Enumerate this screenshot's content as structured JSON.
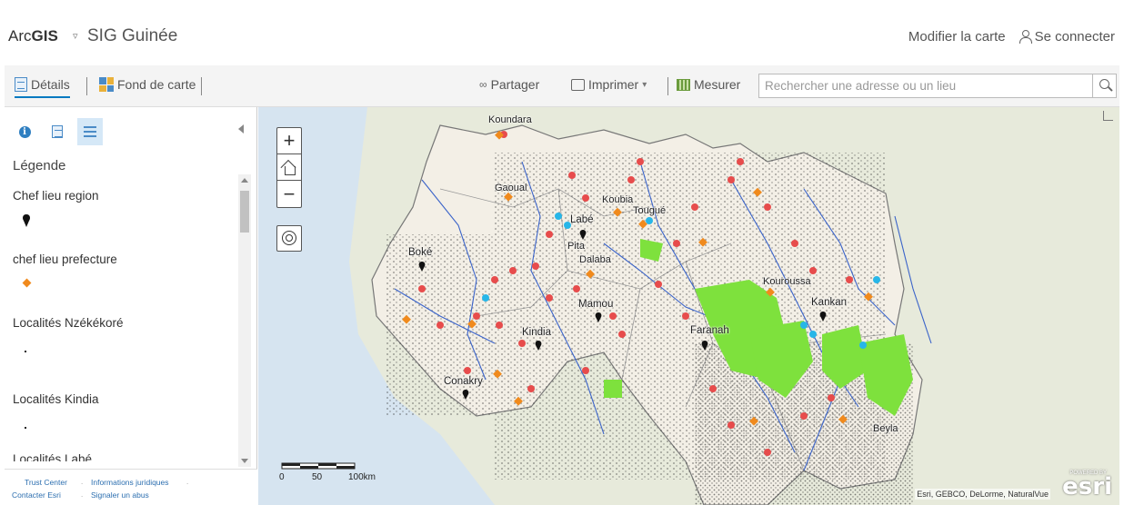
{
  "header": {
    "brand_prefix": "Arc",
    "brand_bold": "GIS",
    "brand_caret": "▿",
    "map_title": "SIG Guinée",
    "modify_map": "Modifier la carte",
    "sign_in": "Se connecter"
  },
  "toolbar": {
    "details": "Détails",
    "basemap": "Fond de carte",
    "share": "Partager",
    "print": "Imprimer",
    "print_caret": "▾",
    "measure": "Mesurer",
    "search_placeholder": "Rechercher une adresse ou un lieu"
  },
  "sidebar": {
    "legend_title": "Légende",
    "layers": [
      {
        "name": "Chef lieu region",
        "symbol": "black-pin"
      },
      {
        "name": "chef lieu prefecture",
        "symbol": "orange-diamond"
      },
      {
        "name": "Localités Nzékékoré",
        "symbol": "dot"
      },
      {
        "name": "Localités Kindia",
        "symbol": "dot"
      },
      {
        "name": "Localités Labé",
        "symbol": "dot"
      }
    ],
    "footer": {
      "trust": "Trust Center",
      "legal": "Informations juridiques",
      "contact": "Contacter Esri",
      "report": "Signaler un abus"
    }
  },
  "map": {
    "zoom_in": "+",
    "zoom_out": "−",
    "cities": [
      {
        "name": "Koundara",
        "symbol": "black-pin"
      },
      {
        "name": "Gaoual",
        "symbol": "black-pin"
      },
      {
        "name": "Koubia",
        "symbol": "black-pin"
      },
      {
        "name": "Tougué",
        "symbol": "black-pin"
      },
      {
        "name": "Labé",
        "symbol": "black-pin"
      },
      {
        "name": "Pita",
        "symbol": "black-pin"
      },
      {
        "name": "Dalaba",
        "symbol": "black-pin"
      },
      {
        "name": "Boké",
        "symbol": "black-pin"
      },
      {
        "name": "Mamou",
        "symbol": "black-pin"
      },
      {
        "name": "Kindia",
        "symbol": "black-pin"
      },
      {
        "name": "Conakry",
        "symbol": "black-pin"
      },
      {
        "name": "Faranah",
        "symbol": "black-pin"
      },
      {
        "name": "Kouroussa",
        "symbol": "black-pin"
      },
      {
        "name": "Kankan",
        "symbol": "black-pin"
      },
      {
        "name": "Beyla",
        "symbol": "black-pin"
      }
    ],
    "scale_labels": [
      "0",
      "50",
      "100km"
    ],
    "attribution": "Esri, GEBCO, DeLorme, NaturalVue",
    "esri_powered": "POWERED BY",
    "esri_logo": "esri",
    "colors": {
      "water": "#d6e4f0",
      "land": "#e8ecde",
      "country": "#f3efe6",
      "rivers": "#3a63c9",
      "forest_green": "#7ee13d",
      "cyan": "#27b6e8",
      "red_points": "#e74c4c",
      "orange_points": "#f08a1d"
    }
  }
}
